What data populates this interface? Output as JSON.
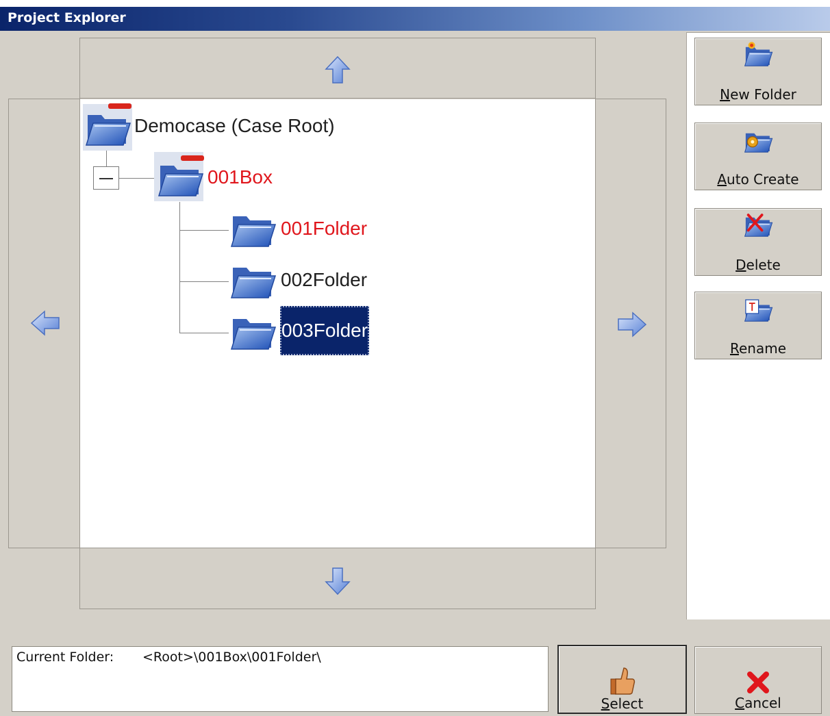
{
  "window": {
    "title": "Project Explorer"
  },
  "tree": {
    "root": {
      "label": "Democase (Case Root)"
    },
    "box": {
      "label": "001Box"
    },
    "folders": [
      {
        "label": "001Folder"
      },
      {
        "label": "002Folder"
      },
      {
        "label": "003Folder"
      }
    ]
  },
  "actions": {
    "new_folder": {
      "mnemonic": "N",
      "rest": "ew Folder"
    },
    "auto_create": {
      "mnemonic": "A",
      "rest": "uto Create"
    },
    "delete": {
      "mnemonic": "D",
      "rest": "elete"
    },
    "rename": {
      "mnemonic": "R",
      "rest": "ename"
    }
  },
  "footer": {
    "current_folder_label": "Current Folder:",
    "current_folder_path": "<Root>\\001Box\\001Folder\\",
    "select": {
      "mnemonic": "S",
      "rest": "elect"
    },
    "cancel": {
      "mnemonic": "C",
      "rest": "ancel"
    }
  },
  "colors": {
    "highlight": "#e0161c",
    "selection": "#0a246a",
    "titlebar": "#0a246a"
  }
}
